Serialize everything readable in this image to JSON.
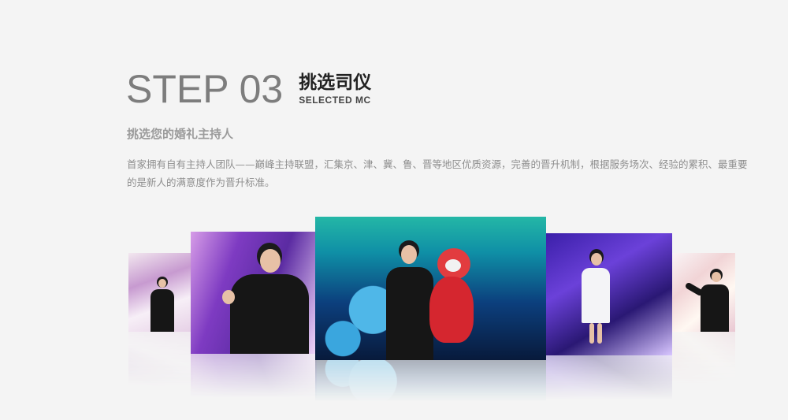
{
  "header": {
    "step_label": "STEP 03",
    "title_cn": "挑选司仪",
    "title_en": "SELECTED MC"
  },
  "content": {
    "subtitle": "挑选您的婚礼主持人",
    "description": "首家拥有自有主持人团队——巅峰主持联盟，汇集京、津、冀、鲁、晋等地区优质资源，完善的晋升机制，根据服务场次、经验的累积、最重要的是新人的满意度作为晋升标准。"
  },
  "gallery": {
    "photos": [
      {
        "name": "mc-photo-1",
        "colors": {
          "accent": "#c79ad0"
        }
      },
      {
        "name": "mc-photo-2",
        "colors": {
          "accent": "#7e3bc2"
        }
      },
      {
        "name": "mc-photo-3",
        "colors": {
          "accent": "#0f8fa6"
        }
      },
      {
        "name": "mc-photo-4",
        "colors": {
          "accent": "#6b41d9"
        }
      },
      {
        "name": "mc-photo-5",
        "colors": {
          "accent": "#f1d4d6"
        }
      }
    ]
  },
  "colors": {
    "background": "#f4f4f4",
    "step_text": "#7d7d7d",
    "title_text": "#222222",
    "subtitle_text": "#9b9b9b",
    "body_text": "#8e8e8e"
  }
}
